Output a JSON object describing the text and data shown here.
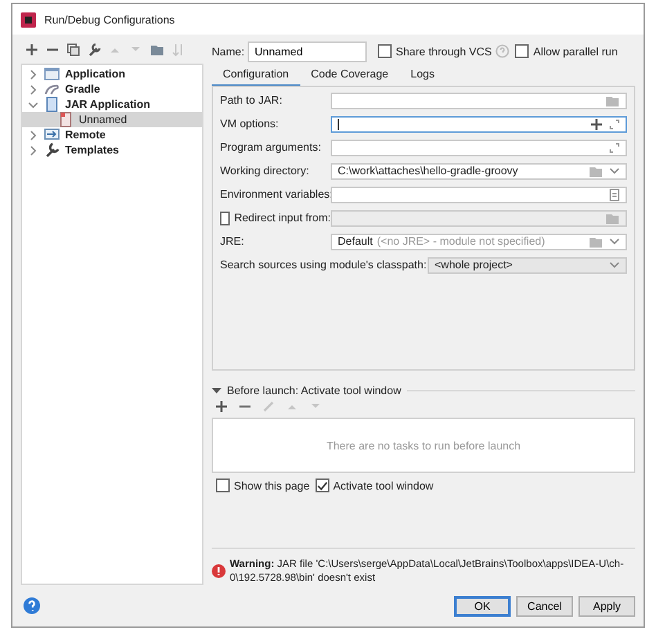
{
  "window": {
    "title": "Run/Debug Configurations"
  },
  "tree": {
    "items": [
      {
        "label": "Application",
        "expanded": false,
        "selected": false
      },
      {
        "label": "Gradle",
        "expanded": false,
        "selected": false
      },
      {
        "label": "JAR Application",
        "expanded": true,
        "selected": false,
        "children": [
          {
            "label": "Unnamed",
            "selected": true
          }
        ]
      },
      {
        "label": "Remote",
        "expanded": false,
        "selected": false
      },
      {
        "label": "Templates",
        "expanded": false,
        "selected": false
      }
    ]
  },
  "name_field": {
    "label": "Name:",
    "value": "Unnamed"
  },
  "options": [
    {
      "label": "Share through VCS",
      "checked": false
    },
    {
      "label": "Allow parallel run",
      "checked": false
    }
  ],
  "tabs": [
    {
      "label": "Configuration",
      "selected": true
    },
    {
      "label": "Code Coverage",
      "selected": false
    },
    {
      "label": "Logs",
      "selected": false
    }
  ],
  "form": [
    {
      "kind": "field",
      "label": "Path to JAR:",
      "focused": false
    },
    {
      "kind": "field",
      "label": "VM options:",
      "focused": true
    },
    {
      "kind": "field",
      "label": "Program arguments:",
      "focused": false
    },
    {
      "kind": "field",
      "label": "Working directory:",
      "value": "C:\\work\\attaches\\hello-gradle-groovy",
      "focused": false
    },
    {
      "kind": "field",
      "label": "Environment variables:",
      "focused": false
    },
    {
      "kind": "checkfield",
      "label": "Redirect input from:",
      "checked": false
    },
    {
      "kind": "field",
      "label": "JRE:",
      "value": "Default",
      "hint": "(<no JRE> - module not specified)",
      "focused": false
    },
    {
      "kind": "combo",
      "label": "Search sources using module's classpath:",
      "value": "<whole project>"
    }
  ],
  "before_launch": {
    "title": "Before launch: Activate tool window",
    "expanded": true,
    "empty_text": "There are no tasks to run before launch",
    "checks": [
      {
        "label": "Show this page",
        "checked": false
      },
      {
        "label": "Activate tool window",
        "checked": true
      }
    ]
  },
  "warning": {
    "text": "**Warning:** JAR file 'C:\\Users\\serge\\AppData\\Local\\JetBrains\\Toolbox\\apps\\IDEA-U\\ch-0\\192.5728.98\\bin' doesn't exist"
  },
  "buttons": [
    {
      "label": "OK",
      "default": true
    },
    {
      "label": "Cancel",
      "default": false
    },
    {
      "label": "Apply",
      "default": false
    }
  ]
}
